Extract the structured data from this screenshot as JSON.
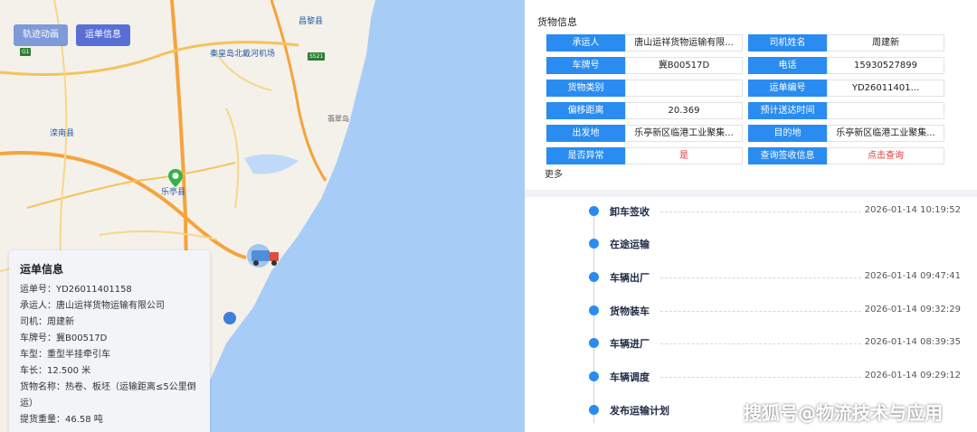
{
  "map": {
    "buttons": {
      "track_label": "轨迹动画",
      "waybill_label": "运单信息"
    },
    "labels": {
      "airport": "秦皇岛北戴河机场",
      "town1": "昌黎县",
      "town2": "滦南县",
      "town3": "乐亭县",
      "town4": "翡翠岛",
      "road1": "G1",
      "road2": "S521"
    },
    "colors": {
      "sea": "#a7cdf7",
      "land": "#f3f1ea",
      "road": "#f4c35b",
      "highway": "#f6a33c"
    },
    "info": {
      "title": "运单信息",
      "waybill_no": "运单号：YD26011401158",
      "carrier": "承运人：唐山运祥货物运输有限公司",
      "driver": "司机：周建新",
      "plate": "车牌号：冀B00517D",
      "vehicle_type": "车型：重型半挂牵引车",
      "length": "车长：12.500 米",
      "goods": "货物名称：热卷、板坯（运输距离≤5公里倒运）",
      "weight": "提货重量：46.58 吨"
    }
  },
  "cargo": {
    "title": "货物信息",
    "rows": [
      {
        "l1": "承运人",
        "v1": "唐山运祥货物运输有限...",
        "l2": "司机姓名",
        "v2": "周建新"
      },
      {
        "l1": "车牌号",
        "v1": "冀B00517D",
        "l2": "电话",
        "v2": "15930527899"
      },
      {
        "l1": "货物类别",
        "v1": "",
        "l2": "运单编号",
        "v2": "YD26011401..."
      },
      {
        "l1": "偏移距离",
        "v1": "20.369",
        "l2": "预计送达时间",
        "v2": ""
      },
      {
        "l1": "出发地",
        "v1": "乐亭新区临港工业聚集...",
        "l2": "目的地",
        "v2": "乐亭新区临港工业聚集..."
      },
      {
        "l1": "是否异常",
        "v1": "是",
        "l2": "查询签收信息",
        "v2": "点击查询"
      }
    ],
    "more": "更多"
  },
  "timeline": [
    {
      "name": "卸车签收",
      "time": "2026-01-14 10:19:52"
    },
    {
      "name": "在途运输",
      "time": ""
    },
    {
      "name": "车辆出厂",
      "time": "2026-01-14 09:47:41"
    },
    {
      "name": "货物装车",
      "time": "2026-01-14 09:32:29"
    },
    {
      "name": "车辆进厂",
      "time": "2026-01-14 08:39:35"
    },
    {
      "name": "车辆调度",
      "time": "2026-01-14 09:29:12"
    },
    {
      "name": "发布运输计划",
      "time": ""
    }
  ],
  "watermark": "搜狐号@物流技术与应用",
  "accent": "#2a8cf0",
  "danger": "#e53935"
}
